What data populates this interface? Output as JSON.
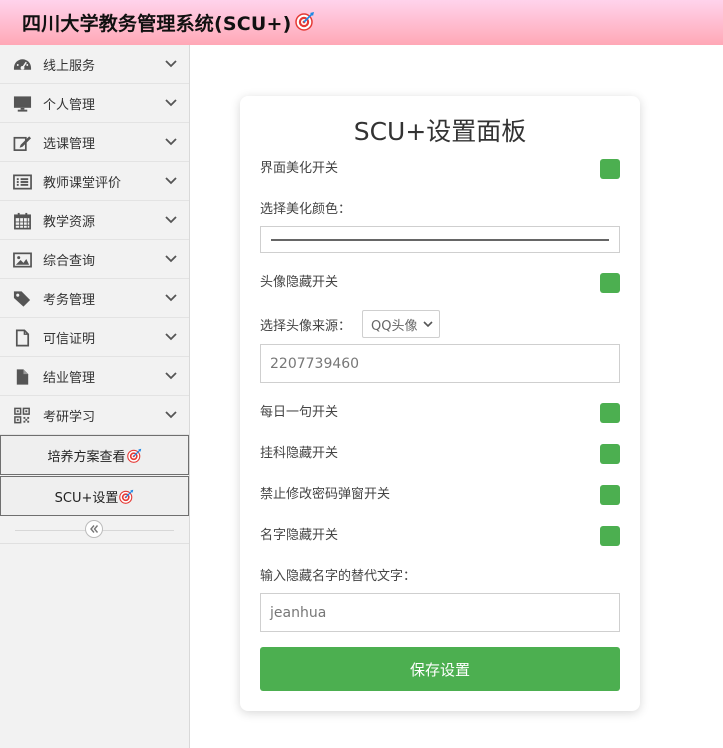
{
  "header": {
    "title": "四川大学教务管理系统(SCU+)",
    "title_icon": "target-icon",
    "gradient": [
      "#ffd3ec",
      "#ffa8b6"
    ]
  },
  "sidebar": {
    "items": [
      {
        "label": "线上服务",
        "icon": "dashboard-icon"
      },
      {
        "label": "个人管理",
        "icon": "desktop-icon"
      },
      {
        "label": "选课管理",
        "icon": "edit-icon"
      },
      {
        "label": "教师课堂评价",
        "icon": "list-icon"
      },
      {
        "label": "教学资源",
        "icon": "calendar-icon"
      },
      {
        "label": "综合查询",
        "icon": "picture-icon"
      },
      {
        "label": "考务管理",
        "icon": "tag-icon"
      },
      {
        "label": "可信证明",
        "icon": "file-icon"
      },
      {
        "label": "结业管理",
        "icon": "file-filled-icon"
      },
      {
        "label": "考研学习",
        "icon": "qrcode-icon"
      }
    ],
    "buttons": [
      {
        "label": "培养方案查看",
        "icon": "target-icon"
      },
      {
        "label": "SCU+设置",
        "icon": "target-icon"
      }
    ],
    "collapse_icon": "double-chevron-left-icon"
  },
  "panel": {
    "title": "SCU+设置面板",
    "beautify_label": "界面美化开关",
    "color_label": "选择美化颜色：",
    "avatar_hide_label": "头像隐藏开关",
    "avatar_source_label": "选择头像来源：",
    "avatar_source_value": "QQ头像",
    "qq_value": "2207739460",
    "daily_quote_label": "每日一句开关",
    "fail_hide_label": "挂科隐藏开关",
    "pwd_popup_label": "禁止修改密码弹窗开关",
    "name_hide_label": "名字隐藏开关",
    "name_replace_label": "输入隐藏名字的替代文字：",
    "name_replace_value": "jeanhua",
    "save_label": "保存设置",
    "accent": "#4caf50",
    "toggles_on": true
  }
}
